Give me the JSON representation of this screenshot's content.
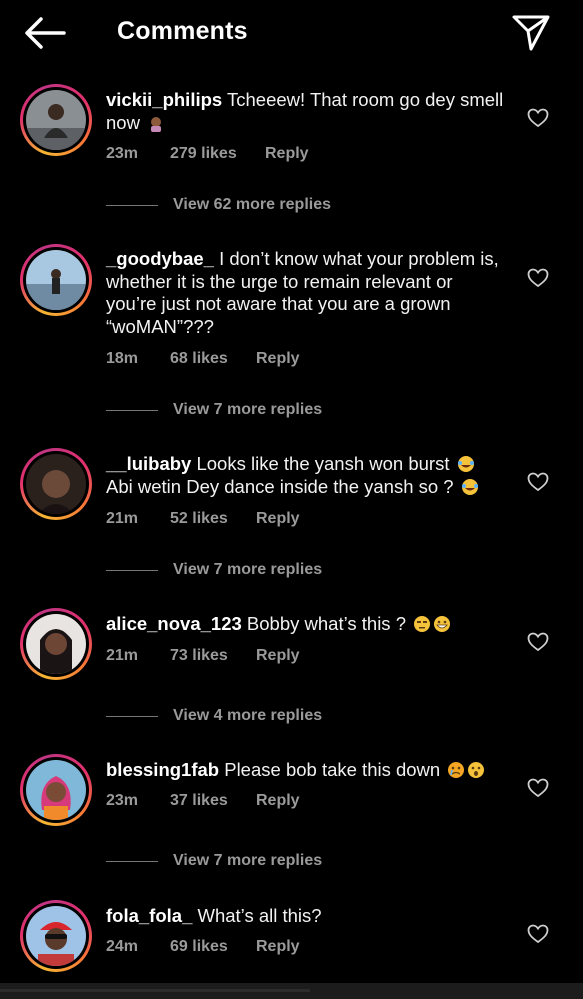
{
  "header": {
    "title": "Comments"
  },
  "comments": [
    {
      "username": "vickii_philips",
      "text": "Tcheeew! That room go dey smell now",
      "time": "23m",
      "likes": "279 likes",
      "reply": "Reply",
      "view_replies": "View 62 more replies"
    },
    {
      "username": "_goodybae_",
      "text": "I don’t know what your problem is, whether it is the urge to remain relevant or you’re just not aware that you are a grown “woMAN”???",
      "time": "18m",
      "likes": "68 likes",
      "reply": "Reply",
      "view_replies": "View 7 more replies"
    },
    {
      "username": "__luibaby",
      "text": "Looks like the yansh won burst",
      "text2": "Abi wetin Dey dance inside the yansh so ?",
      "time": "21m",
      "likes": "52 likes",
      "reply": "Reply",
      "view_replies": "View 7 more replies"
    },
    {
      "username": "alice_nova_123",
      "text": "Bobby what’s this ?",
      "time": "21m",
      "likes": "73 likes",
      "reply": "Reply",
      "view_replies": "View 4 more replies"
    },
    {
      "username": "blessing1fab",
      "text": "Please bob take this down",
      "time": "23m",
      "likes": "37 likes",
      "reply": "Reply",
      "view_replies": "View 7 more replies"
    },
    {
      "username": "fola_fola_",
      "text": "What’s all this?",
      "time": "24m",
      "likes": "69 likes",
      "reply": "Reply"
    }
  ],
  "icons": {
    "back": "arrow-left-icon",
    "share": "send-icon",
    "like": "heart-outline-icon"
  },
  "colors": {
    "background": "#000000",
    "meta": "#9a9a9a",
    "story_ring": "#e1306c"
  }
}
